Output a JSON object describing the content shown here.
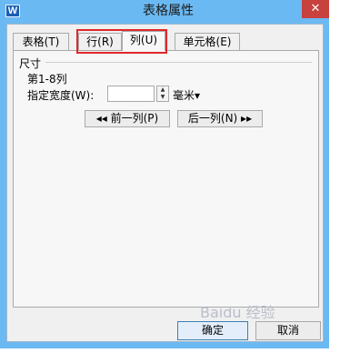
{
  "window": {
    "title": "表格属性",
    "app_icon_letter": "W",
    "close_glyph": "✕"
  },
  "tabs": [
    {
      "label": "表格(T)"
    },
    {
      "label": "行(R)"
    },
    {
      "label": "列(U)"
    },
    {
      "label": "单元格(E)"
    }
  ],
  "panel": {
    "group_label": "尺寸",
    "column_range": "第1-8列",
    "width_label": "指定宽度(W):",
    "width_value": "",
    "unit": "毫米▾",
    "prev_button": "◂◂ 前一列(P)",
    "next_button": "后一列(N) ▸▸"
  },
  "footer": {
    "ok_label": "确定",
    "cancel_label": "取消"
  },
  "watermark": "Baidu 经验"
}
